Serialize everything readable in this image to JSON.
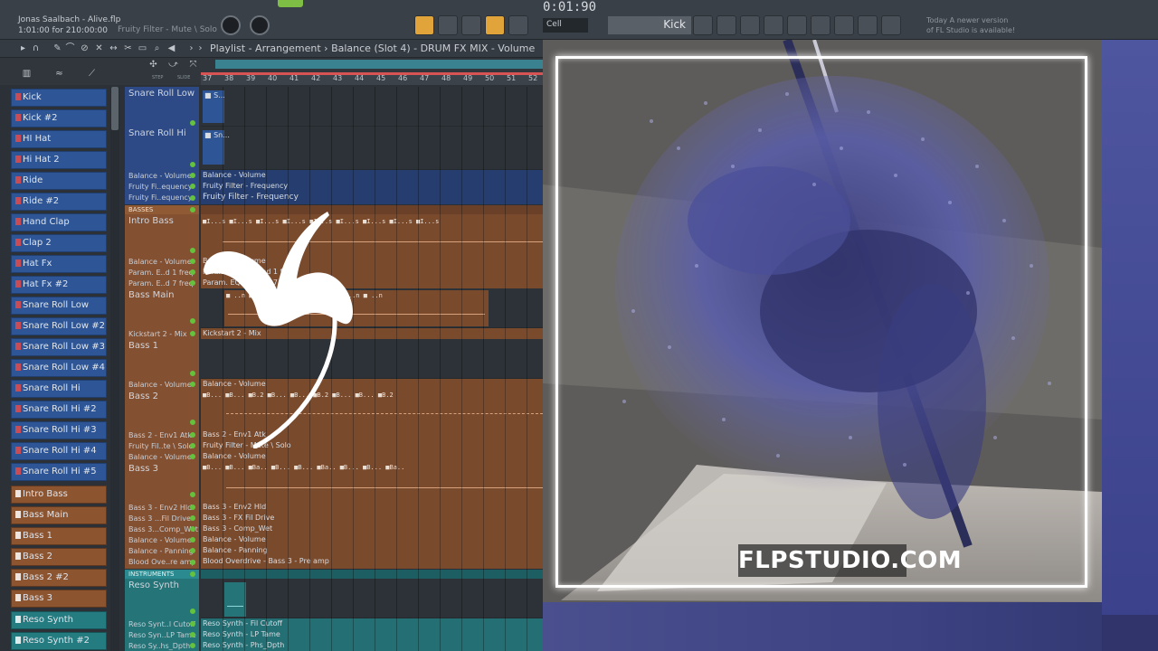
{
  "app": {
    "song_file": "Jonas Saalbach - Alive.flp",
    "time_readout": "1:01:00 for 210:00:00",
    "hint": "Fruity Filter - Mute \\ Solo",
    "tempo": "0:01:90",
    "snap_mode": "Cell",
    "pattern_name": "Kick",
    "news_line1": "Today  A newer version",
    "news_line2": "of FL Studio is available!"
  },
  "playlist": {
    "title": "Playlist - Arrangement",
    "breadcrumb": "Balance (Slot 4) - DRUM FX MIX - Volume",
    "step_label": "STEP",
    "slide_label": "SLIDE",
    "ruler": [
      "37",
      "38",
      "39",
      "40",
      "41",
      "42",
      "43",
      "44",
      "45",
      "46",
      "47",
      "48",
      "49",
      "50",
      "51",
      "52"
    ]
  },
  "channels": [
    {
      "label": "Kick",
      "color": "blue"
    },
    {
      "label": "Kick #2",
      "color": "blue"
    },
    {
      "label": "HI Hat",
      "color": "blue"
    },
    {
      "label": "Hi Hat 2",
      "color": "blue"
    },
    {
      "label": "Ride",
      "color": "blue"
    },
    {
      "label": "Ride #2",
      "color": "blue"
    },
    {
      "label": "Hand Clap",
      "color": "blue"
    },
    {
      "label": "Clap 2",
      "color": "blue"
    },
    {
      "label": "Hat Fx",
      "color": "blue"
    },
    {
      "label": "Hat Fx #2",
      "color": "blue"
    },
    {
      "label": "Snare Roll Low",
      "color": "blue"
    },
    {
      "label": "Snare Roll Low #2",
      "color": "blue"
    },
    {
      "label": "Snare Roll Low #3",
      "color": "blue"
    },
    {
      "label": "Snare Roll Low #4",
      "color": "blue"
    },
    {
      "label": "Snare Roll Hi",
      "color": "blue"
    },
    {
      "label": "Snare Roll Hi #2",
      "color": "blue"
    },
    {
      "label": "Snare Roll Hi #3",
      "color": "blue"
    },
    {
      "label": "Snare Roll Hi #4",
      "color": "blue"
    },
    {
      "label": "Snare Roll Hi #5",
      "color": "blue"
    },
    {
      "label": "Intro Bass",
      "color": "orange"
    },
    {
      "label": "Bass Main",
      "color": "orange"
    },
    {
      "label": "Bass 1",
      "color": "orange"
    },
    {
      "label": "Bass 2",
      "color": "orange"
    },
    {
      "label": "Bass 2 #2",
      "color": "orange"
    },
    {
      "label": "Bass 3",
      "color": "orange"
    },
    {
      "label": "Reso Synth",
      "color": "teal"
    },
    {
      "label": "Reso Synth #2",
      "color": "teal"
    }
  ],
  "tracks": {
    "snare_roll_low": "Snare Roll Low",
    "snare_roll_hi": "Snare Roll Hi",
    "t_balance_vol": "Balance - Volume",
    "t_ff_freq1": "Fruity Fi..equency",
    "t_ff_freq2": "Fruity Fi..equency",
    "section_basses": "BASSES",
    "intro_bass": "Intro Bass",
    "t_balance_vol2": "Balance - Volume",
    "t_param1": "Param. E..d 1 freq",
    "t_param7": "Param. E..d 7 freq",
    "bass_main": "Bass Main",
    "t_kickstart": "Kickstart 2 - Mix",
    "bass_1": "Bass 1",
    "t_balance_vol3": "Balance - Volume",
    "bass_2": "Bass 2",
    "t_bass2_env": "Bass 2 - Env1 Atk",
    "t_ff_solo": "Fruity Fil..te \\ Solo",
    "t_balance_vol4": "Balance - Volume",
    "bass_3": "Bass 3",
    "t_bass3_env": "Bass 3 - Env2 Hld",
    "t_bass3_fil": "Bass 3 ...Fil Drive",
    "t_bass3_comp": "Bass 3...Comp_Wet",
    "t_balance_vol5": "Balance - Volume",
    "t_balance_pan": "Balance - Panning",
    "t_blood": "Blood Ove..re amp",
    "section_instruments": "INSTRUMENTS",
    "reso_synth": "Reso Synth",
    "t_reso_cut": "Reso Synt..l Cutoff",
    "t_reso_lp": "Reso Syn..LP Tame",
    "t_reso_phs": "Reso Sy..hs_Dpth"
  },
  "clips": {
    "c_balance_vol": "Balance - Volume",
    "c_ff_freq1": "Fruity Filter - Frequency",
    "c_ff_freq2": "Fruity Filter - Frequency",
    "c_intro_notes": "■I...s ■I...s ■I...s ■I...s ■I...s ■I...s ■I...s ■I...s ■I...s",
    "c_balance_vol2": "Balance - Volume",
    "c_param1": "Param. EQ2 - Band 1 freq",
    "c_param7": "Param. EQ2 - Band 7 freq",
    "c_bassmain_notes": "■ ..n ■ ..n ■ ..n ■ ..n ■ ..n ■ ..n ■ ..n",
    "c_kickstart": "Kickstart 2 - Mix",
    "c_balance_vol3": "Balance - Volume",
    "c_bass2_notes": "■B... ■B... ■B.2 ■B... ■B... ■B.2 ■B... ■B... ■B.2",
    "c_bass2_env": "Bass 2 - Env1 Atk",
    "c_ff_solo": "Fruity Filter - Mute \\ Solo",
    "c_balance_vol4": "Balance - Volume",
    "c_bass3_notes": "■B... ■B... ■Ba.. ■B... ■B... ■Ba.. ■B... ■B... ■Ba..",
    "c_bass3_env": "Bass 3 - Env2 Hld",
    "c_bass3_fil": "Bass 3 - FX Fil Drive",
    "c_bass3_comp": "Bass 3 - Comp_Wet",
    "c_balance_vol5": "Balance - Volume",
    "c_balance_pan": "Balance - Panning",
    "c_blood": "Blood Overdrive - Bass 3 - Pre amp",
    "c_reso_cut": "Reso Synth - Fil Cutoff",
    "c_reso_lp": "Reso Synth - LP Tame",
    "c_reso_phs": "Reso Synth - Phs_Dpth",
    "c_snare_low": "■ S...",
    "c_snare_hi": "■ Sn..."
  },
  "overlay": {
    "watermark": "FLPSTUDIO.COM",
    "logo_icon": "fl-fruit-logo"
  },
  "colors": {
    "blue_track": "#2e5696",
    "orange_track": "#8d5430",
    "teal_track": "#247b80",
    "accent_orange": "#e0a43a",
    "led_green": "#64c23d",
    "ruler_red": "#d85454"
  }
}
